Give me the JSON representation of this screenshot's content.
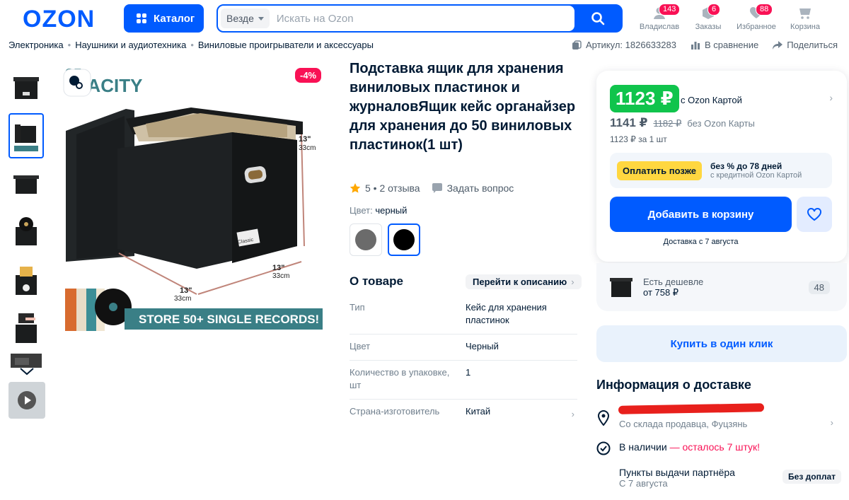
{
  "header": {
    "logo": "OZON",
    "catalog_label": "Каталог",
    "search_scope": "Везде",
    "search_placeholder": "Искать на Ozon",
    "items": [
      {
        "label": "Владислав",
        "badge": "143",
        "icon": "user-icon"
      },
      {
        "label": "Заказы",
        "badge": "6",
        "icon": "box-icon"
      },
      {
        "label": "Избранное",
        "badge": "88",
        "icon": "heart-icon"
      },
      {
        "label": "Корзина",
        "badge": "",
        "icon": "cart-icon"
      }
    ]
  },
  "breadcrumbs": [
    "Электроника",
    "Наушники и аудиотехника",
    "Виниловые проигрыватели и аксессуары"
  ],
  "meta": {
    "article": "Артикул: 1826633283",
    "compare": "В сравнение",
    "share": "Поделиться"
  },
  "gallery": {
    "discount_badge": "-4%",
    "image_caption": "STORE 50+ SINGLE RECORDS!",
    "image_brand_fragment_1": "GE",
    "image_brand_fragment_2": "PACITY",
    "dim_1_in": "13\"",
    "dim_1_cm": "33cm",
    "dim_2_in": "13\"",
    "dim_2_cm": "33cm",
    "dim_3_in": "13\"",
    "dim_3_cm": "33cm",
    "label_text": "Classic"
  },
  "product": {
    "title": "Подставка ящик для хранения виниловых пластинок и журналовЯщик кейс органайзер для хранения до 50 виниловых пластинок(1 шт)",
    "rating": "5 • 2 отзыва",
    "ask_question": "Задать вопрос",
    "color_label": "Цвет:",
    "color_value": "черный",
    "swatches": [
      "#6b6b6b",
      "#000000"
    ],
    "about_heading": "О товаре",
    "to_description": "Перейти к описанию",
    "specs": [
      {
        "key": "Тип",
        "value": "Кейс для хранения пластинок"
      },
      {
        "key": "Цвет",
        "value": "Черный"
      },
      {
        "key": "Количество в упаковке, шт",
        "value": "1"
      },
      {
        "key": "Страна-изготовитель",
        "value": "Китай"
      }
    ]
  },
  "price_card": {
    "ozon_card_price": "1123 ₽",
    "ozon_card_label": "с Ozon Картой",
    "regular_price": "1141 ₽",
    "old_price": "1182 ₽",
    "regular_label": "без Ozon Карты",
    "per_unit": "1123 ₽ за 1 шт",
    "pay_later_button": "Оплатить позже",
    "pay_later_title": "без % до 78 дней",
    "pay_later_sub": "с кредитной Ozon Картой",
    "add_to_cart": "Добавить в корзину",
    "delivery_note": "Доставка с 7 августа"
  },
  "cheaper": {
    "label": "Есть дешевле",
    "price": "от 758 ₽",
    "count": "48"
  },
  "one_click": "Купить в один клик",
  "delivery": {
    "heading": "Информация о доставке",
    "warehouse": "Со склада продавца, Фуцзянь",
    "in_stock": "В наличии",
    "stock_left": "— осталось 7 штук!",
    "pickup_title": "Пункты выдачи партнёра",
    "pickup_date": "С 7 августа",
    "no_extra": "Без доплат"
  },
  "colors": {
    "brand_blue": "#005bff",
    "green_price": "#10c44c",
    "badge_pink": "#f91155",
    "teal_banner": "#3a7f86"
  }
}
